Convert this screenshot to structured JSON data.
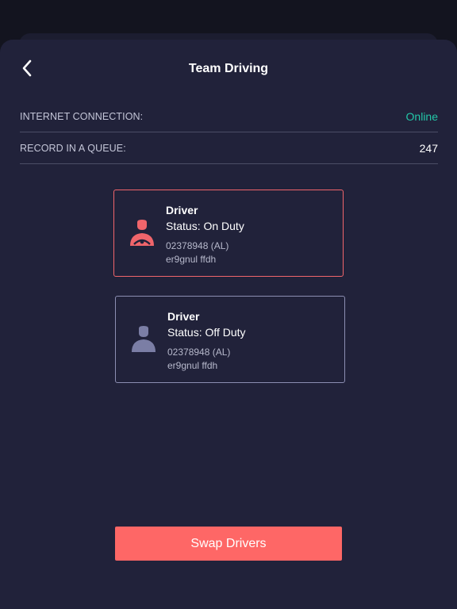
{
  "header": {
    "title": "Team Driving",
    "back_icon": "chevron-left-icon"
  },
  "info": {
    "internet_label": "INTERNET CONNECTION:",
    "internet_value": "Online",
    "queue_label": "RECORD IN A QUEUE:",
    "queue_value": "247"
  },
  "drivers": [
    {
      "role": "Driver",
      "status": "Status: On Duty",
      "id": "02378948 (AL)",
      "name": "er9gnul ffdh",
      "icon": "driver-steering-icon",
      "accent": "#f0656b"
    },
    {
      "role": "Driver",
      "status": "Status: Off Duty",
      "id": "02378948 (AL)",
      "name": "er9gnul ffdh",
      "icon": "person-icon",
      "accent": "#8c8eb2"
    }
  ],
  "actions": {
    "swap_label": "Swap Drivers"
  },
  "colors": {
    "background": "#21223a",
    "online": "#23c7a8",
    "primary": "#fe6766"
  }
}
